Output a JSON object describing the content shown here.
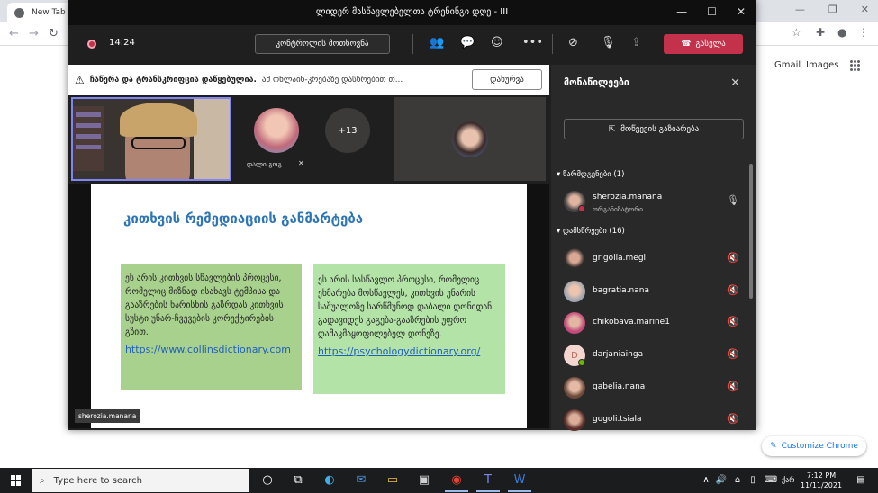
{
  "browser": {
    "tab_title": "New Tab",
    "gmail": "Gmail",
    "images": "Images",
    "customize_label": "Customize Chrome"
  },
  "teams": {
    "window_title": "ლიდერ მასწავლებელთა ტრენინგი დღე - III",
    "timer": "14:24",
    "control_button": "კონტროლის მოთხოვნა",
    "leave_button": "გასვლა",
    "banner_bold": "ჩაწერა და ტრანსკრიფცია დაწყებულია.",
    "banner_text": "ამ ონლაინ-კრებაზე დასწრებით თ...",
    "banner_close": "დახურვა",
    "tiles": {
      "participant_name": "დალი გოგ...",
      "overflow_count": "+13"
    },
    "presenter_label": "sherozia.manana",
    "accent_color": "#7f85f5",
    "leave_color": "#c4314b"
  },
  "slide": {
    "title": "კითხვის რემედიაციის განმარტება",
    "left_text": "ეს არის კითხვის სწავლების პროცესი, რომელიც მიზნად ისახავს ტემპისა და გააზრების ხარისხის გაზრდას კითხვის სუსტი უნარ-ჩვევების კორექტირების გზით.",
    "left_link": "https://www.collinsdictionary.com",
    "right_text": "ეს არის სასწავლო პროცესი, რომელიც ეხმარება მოსწავლეს, კითხვის უნარის საშუალოზე სარწმუნოდ დაბალი დონიდან გადავიდეს გაგება-გააზრების უფრო დამაკმაყოფილებელ დონეზე.",
    "right_link": "https://psychologydictionary.org/"
  },
  "panel": {
    "title": "მონაწილეები",
    "share_invite": "მოწვევის გაზიარება",
    "presenters_header": "წარმდგენები (1)",
    "attendees_header": "დამსწრეები (16)",
    "presenters": [
      {
        "name": "sherozia.manana",
        "role": "ორგანიზატორი"
      }
    ],
    "attendees": [
      {
        "name": "grigolia.megi"
      },
      {
        "name": "bagratia.nana"
      },
      {
        "name": "chikobava.marine1"
      },
      {
        "name": "darjaniainga",
        "initial": "D"
      },
      {
        "name": "gabelia.nana"
      },
      {
        "name": "gogoli.tsiala"
      }
    ]
  },
  "taskbar": {
    "search_placeholder": "Type here to search",
    "time": "7:12 PM",
    "date": "11/11/2021",
    "lang": "ქარ"
  }
}
